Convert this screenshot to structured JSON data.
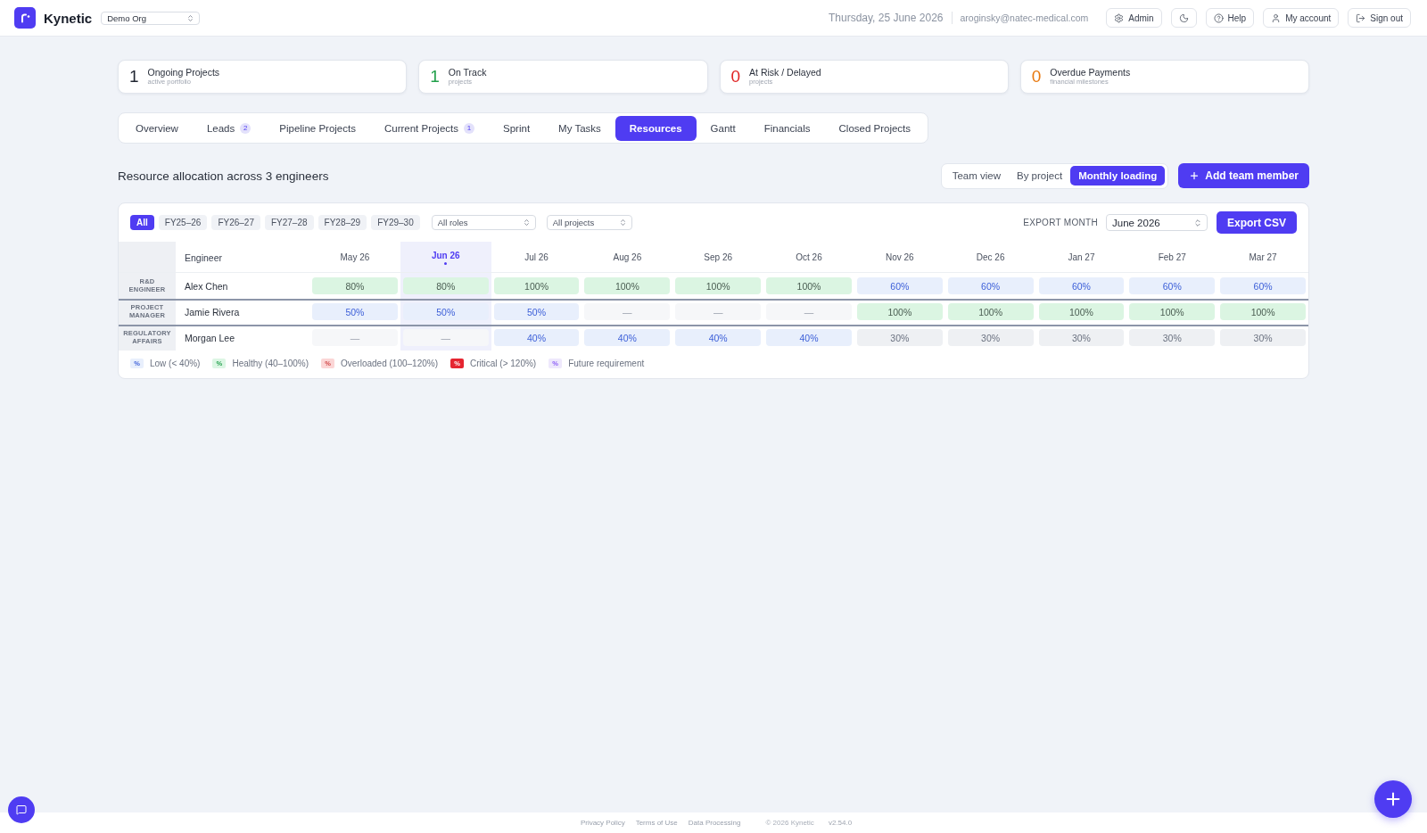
{
  "topbar": {
    "brand": "Kynetic",
    "org_select": "Demo Org",
    "date": "Thursday, 25 June 2026",
    "email": "aroginsky@natec-medical.com",
    "actions": [
      {
        "kind": "admin",
        "label": "Admin"
      },
      {
        "kind": "theme"
      },
      {
        "kind": "help",
        "label": "Help"
      },
      {
        "kind": "account",
        "label": "My account"
      },
      {
        "kind": "signout",
        "label": "Sign out"
      }
    ]
  },
  "stats": [
    {
      "value": "1",
      "label": "Ongoing Projects",
      "sub": "active portfolio",
      "color": "#1f2430"
    },
    {
      "value": "1",
      "label": "On Track",
      "sub": "projects",
      "color": "#22a04b"
    },
    {
      "value": "0",
      "label": "At Risk / Delayed",
      "sub": "projects",
      "color": "#e02424"
    },
    {
      "value": "0",
      "label": "Overdue Payments",
      "sub": "financial milestones",
      "color": "#e8780e"
    }
  ],
  "tabs": [
    {
      "label": "Overview",
      "selected": false
    },
    {
      "label": "Leads",
      "count": "2",
      "selected": false
    },
    {
      "label": "Pipeline Projects",
      "selected": false
    },
    {
      "label": "Current Projects",
      "count": "1",
      "selected": false
    },
    {
      "label": "Sprint",
      "selected": false
    },
    {
      "label": "My Tasks",
      "selected": false
    },
    {
      "label": "Resources",
      "selected": true
    },
    {
      "label": "Gantt",
      "selected": false
    },
    {
      "label": "Financials",
      "selected": false
    },
    {
      "label": "Closed Projects",
      "selected": false
    }
  ],
  "resources": {
    "heading": "Resource allocation across 3 engineers",
    "views": [
      {
        "label": "Team view",
        "selected": false
      },
      {
        "label": "By project",
        "selected": false
      },
      {
        "label": "Monthly loading",
        "selected": true
      }
    ],
    "add_button": "Add team member",
    "filters": {
      "years": [
        {
          "label": "All",
          "selected": true
        },
        {
          "label": "FY25–26",
          "selected": false
        },
        {
          "label": "FY26–27",
          "selected": false
        },
        {
          "label": "FY27–28",
          "selected": false
        },
        {
          "label": "FY28–29",
          "selected": false
        },
        {
          "label": "FY29–30",
          "selected": false
        }
      ],
      "role_select": "All roles",
      "project_select": "All projects",
      "export_label": "EXPORT MONTH",
      "export_month": "June 2026",
      "export_button": "Export CSV"
    },
    "table": {
      "engineer_heading": "Engineer",
      "months": [
        {
          "label": "May 26",
          "current": false
        },
        {
          "label": "Jun 26",
          "current": true
        },
        {
          "label": "Jul 26",
          "current": false
        },
        {
          "label": "Aug 26",
          "current": false
        },
        {
          "label": "Sep 26",
          "current": false
        },
        {
          "label": "Oct 26",
          "current": false
        },
        {
          "label": "Nov 26",
          "current": false
        },
        {
          "label": "Dec 26",
          "current": false
        },
        {
          "label": "Jan 27",
          "current": false
        },
        {
          "label": "Feb 27",
          "current": false
        },
        {
          "label": "Mar 27",
          "current": false
        }
      ],
      "rows": [
        {
          "role": "R&D ENGINEER",
          "engineer": "Alex Chen",
          "cells": [
            {
              "value": "80%",
              "kind": "healthy"
            },
            {
              "value": "80%",
              "kind": "healthy"
            },
            {
              "value": "100%",
              "kind": "healthy"
            },
            {
              "value": "100%",
              "kind": "healthy"
            },
            {
              "value": "100%",
              "kind": "healthy"
            },
            {
              "value": "100%",
              "kind": "healthy"
            },
            {
              "value": "60%",
              "kind": "low"
            },
            {
              "value": "60%",
              "kind": "low"
            },
            {
              "value": "60%",
              "kind": "low"
            },
            {
              "value": "60%",
              "kind": "low"
            },
            {
              "value": "60%",
              "kind": "low"
            }
          ]
        },
        {
          "role": "PROJECT MANAGER",
          "engineer": "Jamie Rivera",
          "cells": [
            {
              "value": "50%",
              "kind": "low"
            },
            {
              "value": "50%",
              "kind": "low"
            },
            {
              "value": "50%",
              "kind": "low"
            },
            {
              "value": "—",
              "kind": "empty"
            },
            {
              "value": "—",
              "kind": "empty"
            },
            {
              "value": "—",
              "kind": "empty"
            },
            {
              "value": "100%",
              "kind": "healthy"
            },
            {
              "value": "100%",
              "kind": "healthy"
            },
            {
              "value": "100%",
              "kind": "healthy"
            },
            {
              "value": "100%",
              "kind": "healthy"
            },
            {
              "value": "100%",
              "kind": "healthy"
            }
          ]
        },
        {
          "role": "REGULATORY AFFAIRS",
          "engineer": "Morgan Lee",
          "cells": [
            {
              "value": "—",
              "kind": "empty"
            },
            {
              "value": "—",
              "kind": "empty"
            },
            {
              "value": "40%",
              "kind": "low"
            },
            {
              "value": "40%",
              "kind": "low"
            },
            {
              "value": "40%",
              "kind": "low"
            },
            {
              "value": "40%",
              "kind": "low"
            },
            {
              "value": "30%",
              "kind": "neutral"
            },
            {
              "value": "30%",
              "kind": "neutral"
            },
            {
              "value": "30%",
              "kind": "neutral"
            },
            {
              "value": "30%",
              "kind": "neutral"
            },
            {
              "value": "30%",
              "kind": "neutral"
            }
          ]
        }
      ]
    },
    "legend": [
      {
        "symbol": "%",
        "label": "Low (< 40%)",
        "kind": "low"
      },
      {
        "symbol": "%",
        "label": "Healthy (40–100%)",
        "kind": "healthy"
      },
      {
        "symbol": "%",
        "label": "Overloaded (100–120%)",
        "kind": "overloaded"
      },
      {
        "symbol": "%",
        "label": "Critical (> 120%)",
        "kind": "critical"
      },
      {
        "symbol": "%",
        "label": "Future requirement",
        "kind": "future"
      }
    ]
  },
  "footer": {
    "links": [
      "Privacy Policy",
      "Terms of Use",
      "Data Processing"
    ],
    "copyright": "© 2026 Kynetic",
    "version": "v2.54.0"
  }
}
